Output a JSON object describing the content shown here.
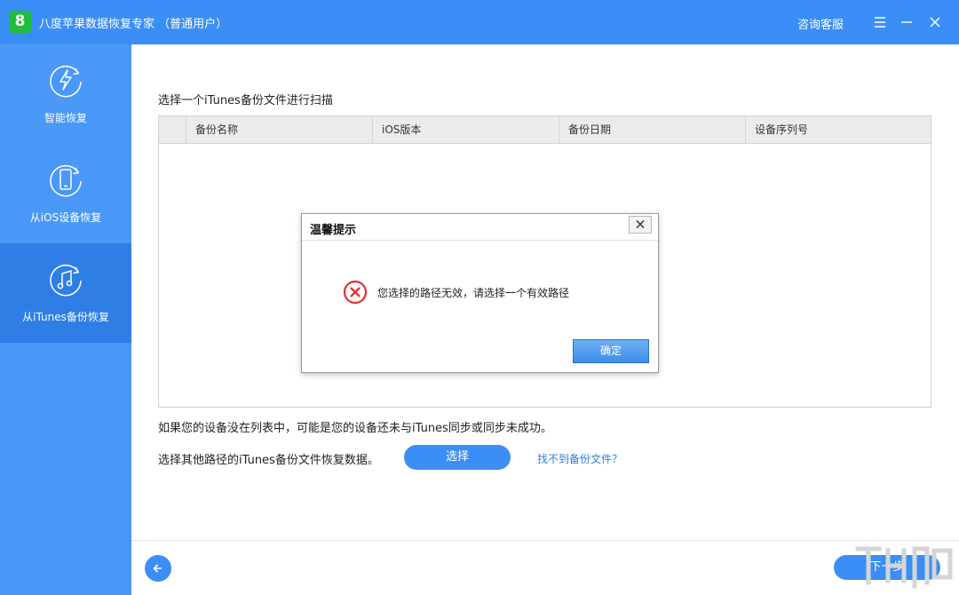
{
  "titlebar": {
    "logo_text": "8",
    "app_title": "八度苹果数据恢复专家 （普通用户）",
    "support_label": "咨询客服"
  },
  "sidebar": {
    "items": [
      {
        "label": "智能恢复",
        "icon": "lightning-refresh-icon",
        "active": false
      },
      {
        "label": "从iOS设备恢复",
        "icon": "phone-refresh-icon",
        "active": false
      },
      {
        "label": "从iTunes备份恢复",
        "icon": "music-refresh-icon",
        "active": true
      }
    ]
  },
  "main": {
    "section_title": "选择一个iTunes备份文件进行扫描",
    "table": {
      "columns": [
        "备份名称",
        "iOS版本",
        "备份日期",
        "设备序列号"
      ]
    },
    "note": "如果您的设备没在列表中，可能是您的设备还未与iTunes同步或同步未成功。",
    "other_path_label": "选择其他路径的iTunes备份文件恢复数据。",
    "select_button": "选择",
    "help_link": "找不到备份文件？",
    "next_button": "下一步"
  },
  "dialog": {
    "title": "温馨提示",
    "message": "您选择的路径无效，请选择一个有效路径",
    "ok_button": "确定"
  },
  "colors": {
    "titlebar": "#3b8ef5",
    "sidebar": "#4a98f7",
    "sidebar_active": "#2f7ee6",
    "logo": "#1fbd3a",
    "error": "#e03232"
  }
}
